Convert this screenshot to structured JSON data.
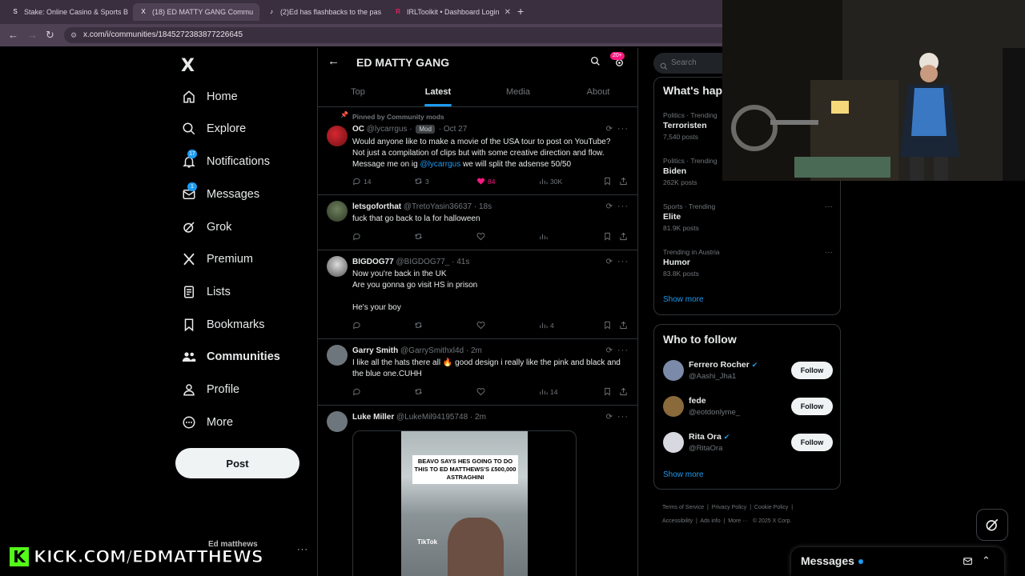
{
  "browser": {
    "tabs": [
      {
        "title": "Stake: Online Casino & Sports B",
        "favicon": "S"
      },
      {
        "title": "(18) ED MATTY GANG Commu",
        "favicon": "X"
      },
      {
        "title": "(2)Ed has flashbacks to the pas",
        "favicon": "♪"
      },
      {
        "title": "IRLToolkit • Dashboard Login",
        "favicon": "R"
      }
    ],
    "new_tab": "+",
    "url": "x.com/i/communities/1845272383877226645"
  },
  "nav": {
    "logo": "X",
    "items": [
      {
        "label": "Home",
        "icon": "home-icon"
      },
      {
        "label": "Explore",
        "icon": "search-icon"
      },
      {
        "label": "Notifications",
        "icon": "bell-icon",
        "badge": "17"
      },
      {
        "label": "Messages",
        "icon": "envelope-icon",
        "badge": "1"
      },
      {
        "label": "Grok",
        "icon": "grok-icon"
      },
      {
        "label": "Premium",
        "icon": "x-premium-icon"
      },
      {
        "label": "Lists",
        "icon": "list-icon"
      },
      {
        "label": "Bookmarks",
        "icon": "bookmark-icon"
      },
      {
        "label": "Communities",
        "icon": "communities-icon"
      },
      {
        "label": "Profile",
        "icon": "profile-icon"
      },
      {
        "label": "More",
        "icon": "more-circle-icon"
      }
    ],
    "post_label": "Post",
    "account_name": "Ed matthews"
  },
  "community": {
    "title": "ED MATTY GANG",
    "notif_badge": "20+",
    "tabs": [
      "Top",
      "Latest",
      "Media",
      "About"
    ],
    "active_tab": "Latest"
  },
  "tweets": [
    {
      "pinned_label": "Pinned by Community mods",
      "name": "OC",
      "handle": "@lycarrgus",
      "mod_tag": "Mod",
      "time": "Oct 27",
      "text_lines": [
        "Would anyone like to make a movie of the USA tour to post on YouTube?",
        "Not just a compilation of clips but with some creative direction and flow."
      ],
      "text_line3_pre": "Message me on ig ",
      "text_line3_link": "@lycarrgus",
      "text_line3_post": " we will split the adsense 50/50",
      "replies": "14",
      "reposts": "3",
      "likes": "84",
      "views": "30K"
    },
    {
      "name": "letsgoforthat",
      "handle": "@TretoYasin36637",
      "time": "18s",
      "text_lines": [
        "fuck that go back to la for halloween"
      ],
      "replies": "",
      "reposts": "",
      "likes": "",
      "views": ""
    },
    {
      "name": "BIGDOG77",
      "handle": "@BIGDOG77_",
      "time": "41s",
      "text_lines": [
        "Now you're back in the UK",
        "Are you gonna go visit HS in prison",
        "",
        "He's your boy"
      ],
      "replies": "",
      "reposts": "",
      "likes": "",
      "views": "4"
    },
    {
      "name": "Garry Smith",
      "handle": "@GarrySmithxl4d",
      "time": "2m",
      "text_lines": [
        "I like all the hats there all 🔥 good design i really like the pink and black and",
        "the blue one.CUHH"
      ],
      "replies": "",
      "reposts": "",
      "likes": "",
      "views": "14"
    },
    {
      "name": "Luke Miller",
      "handle": "@LukeMil94195748",
      "time": "2m",
      "media_caption": "BEAVO SAYS HES GOING TO DO THIS TO ED MATTHEWS'S £500,000 ASTRAGHINI",
      "media_watermark": "TikTok"
    }
  ],
  "sidebar": {
    "search_placeholder": "Search",
    "whats_happening": "What's hap",
    "trends": [
      {
        "context": "Politics · Trending",
        "topic": "Terroristen",
        "count": "7,540 posts"
      },
      {
        "context": "Politics · Trending",
        "topic": "Biden",
        "count": "262K posts"
      },
      {
        "context": "Sports · Trending",
        "topic": "Elite",
        "count": "81.9K posts"
      },
      {
        "context": "Trending in Austria",
        "topic": "Humor",
        "count": "83.8K posts"
      }
    ],
    "show_more": "Show more",
    "who_to_follow": "Who to follow",
    "suggestions": [
      {
        "name": "Ferrero Rocher",
        "handle": "@Aashi_Jha1",
        "verified": true,
        "avatar_color": "#7b8aa8"
      },
      {
        "name": "fede",
        "handle": "@eotdonlyme_",
        "verified": false,
        "avatar_color": "#8a6a3a"
      },
      {
        "name": "Rita Ora",
        "handle": "@RitaOra",
        "verified": true,
        "avatar_color": "#d8d8e0"
      }
    ],
    "follow_label": "Follow",
    "footer_line1": [
      "Terms of Service",
      "Privacy Policy",
      "Cookie Policy"
    ],
    "footer_line2": [
      "Accessibility",
      "Ads info",
      "More ···",
      "© 2025 X Corp."
    ]
  },
  "messages_drawer": {
    "title": "Messages"
  },
  "overlay": {
    "kick_logo": "K",
    "kick_text": "KICK.COM/EDMATTHEWS"
  },
  "colors": {
    "accent": "#1d9bf0",
    "like": "#f91880",
    "kick": "#53fc18"
  }
}
